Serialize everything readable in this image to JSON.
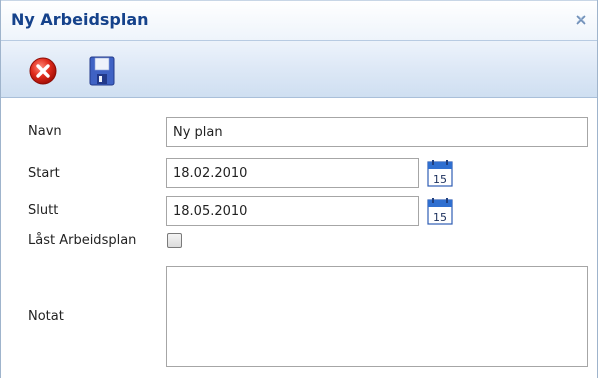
{
  "window": {
    "title": "Ny Arbeidsplan",
    "title_color": "#15428b"
  },
  "toolbar": {
    "cancel_icon": "cancel-icon",
    "save_icon": "save-icon"
  },
  "form": {
    "name": {
      "label": "Navn",
      "value": "Ny plan"
    },
    "start": {
      "label": "Start",
      "value": "18.02.2010",
      "calendar_day": "15"
    },
    "end": {
      "label": "Slutt",
      "value": "18.05.2010",
      "calendar_day": "15"
    },
    "locked": {
      "label": "Låst Arbeidsplan",
      "checked": false
    },
    "notes": {
      "label": "Notat",
      "value": ""
    }
  }
}
